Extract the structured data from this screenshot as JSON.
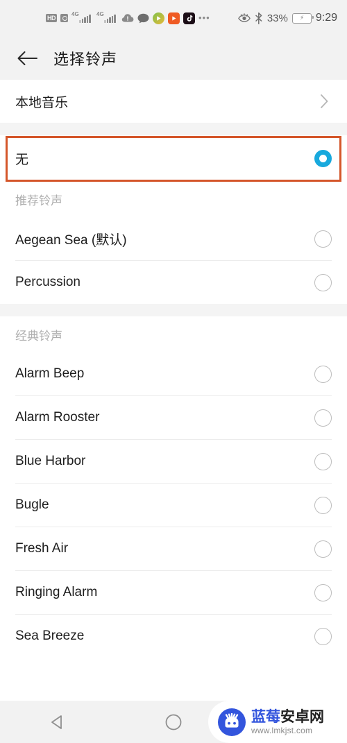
{
  "statusbar": {
    "hd_label": "HD",
    "network_left": "4G",
    "network_right": "4G",
    "icons": [
      "hd-badge",
      "sim-lock-icon",
      "signal-4g-icon",
      "signal-4g-secondary-icon",
      "cloud-alert-icon",
      "chat-bubble-icon",
      "play-app-icon",
      "video-app-icon",
      "tiktok-app-icon",
      "more-icon"
    ],
    "eye_icon": "eye-comfort-icon",
    "bluetooth_icon": "bluetooth-icon",
    "battery_percent": "33%",
    "battery_icon": "battery-charging-icon",
    "time": "9:29"
  },
  "header": {
    "back_icon": "back-arrow-icon",
    "title": "选择铃声"
  },
  "local_music": {
    "label": "本地音乐",
    "chevron_icon": "chevron-right-icon"
  },
  "none_row": {
    "label": "无",
    "selected": true,
    "radio_icon": "radio-selected-icon"
  },
  "sections": [
    {
      "title": "推荐铃声",
      "items": [
        {
          "label": "Aegean Sea (默认)",
          "selected": false
        },
        {
          "label": "Percussion",
          "selected": false
        }
      ]
    },
    {
      "title": "经典铃声",
      "items": [
        {
          "label": "Alarm Beep",
          "selected": false
        },
        {
          "label": "Alarm Rooster",
          "selected": false
        },
        {
          "label": "Blue Harbor",
          "selected": false
        },
        {
          "label": "Bugle",
          "selected": false
        },
        {
          "label": "Fresh Air",
          "selected": false
        },
        {
          "label": "Ringing Alarm",
          "selected": false
        },
        {
          "label": "Sea Breeze",
          "selected": false
        }
      ]
    }
  ],
  "navbar": {
    "back_icon": "nav-back-triangle-icon",
    "home_icon": "nav-home-circle-icon"
  },
  "watermark": {
    "logo_icon": "android-mascot-logo-icon",
    "name_part1": "蓝莓",
    "name_part2": "安卓网",
    "url": "www.lmkjst.com"
  },
  "colors": {
    "accent_selected": "#18a9dd",
    "annotation_box": "#d4562a",
    "bar_background": "#f2f2f2",
    "watermark_blue": "#3355dd"
  }
}
